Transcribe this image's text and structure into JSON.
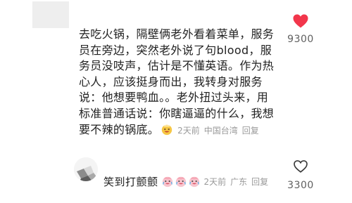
{
  "comment": {
    "text": "去吃火锅，隔壁俩老外看着菜单，服务员在旁边，突然老外说了句blood，服务员没吱声，估计是不懂英语。作为热心人，应该挺身而出，我转身对服务说：他想要鸭血。。老外扭过头来，用标准普通话说：你瞎逼逼的什么，我想要不辣的锅底。",
    "time": "2天前",
    "location": "中国台湾",
    "reply_label": "回复",
    "like_count": "9300",
    "liked": true
  },
  "reply": {
    "text": "笑到打颤颤",
    "emoji_count": 3,
    "time": "2天前",
    "location": "广东",
    "reply_label": "回复",
    "like_count": "3300",
    "liked": false
  },
  "colors": {
    "heart_red": "#f2364b",
    "meta_gray": "#9a9a9a"
  },
  "icons": {
    "liked": "heart-filled-icon",
    "unliked": "heart-outline-icon",
    "emoji": "laugh-cry-emoji-icon"
  }
}
